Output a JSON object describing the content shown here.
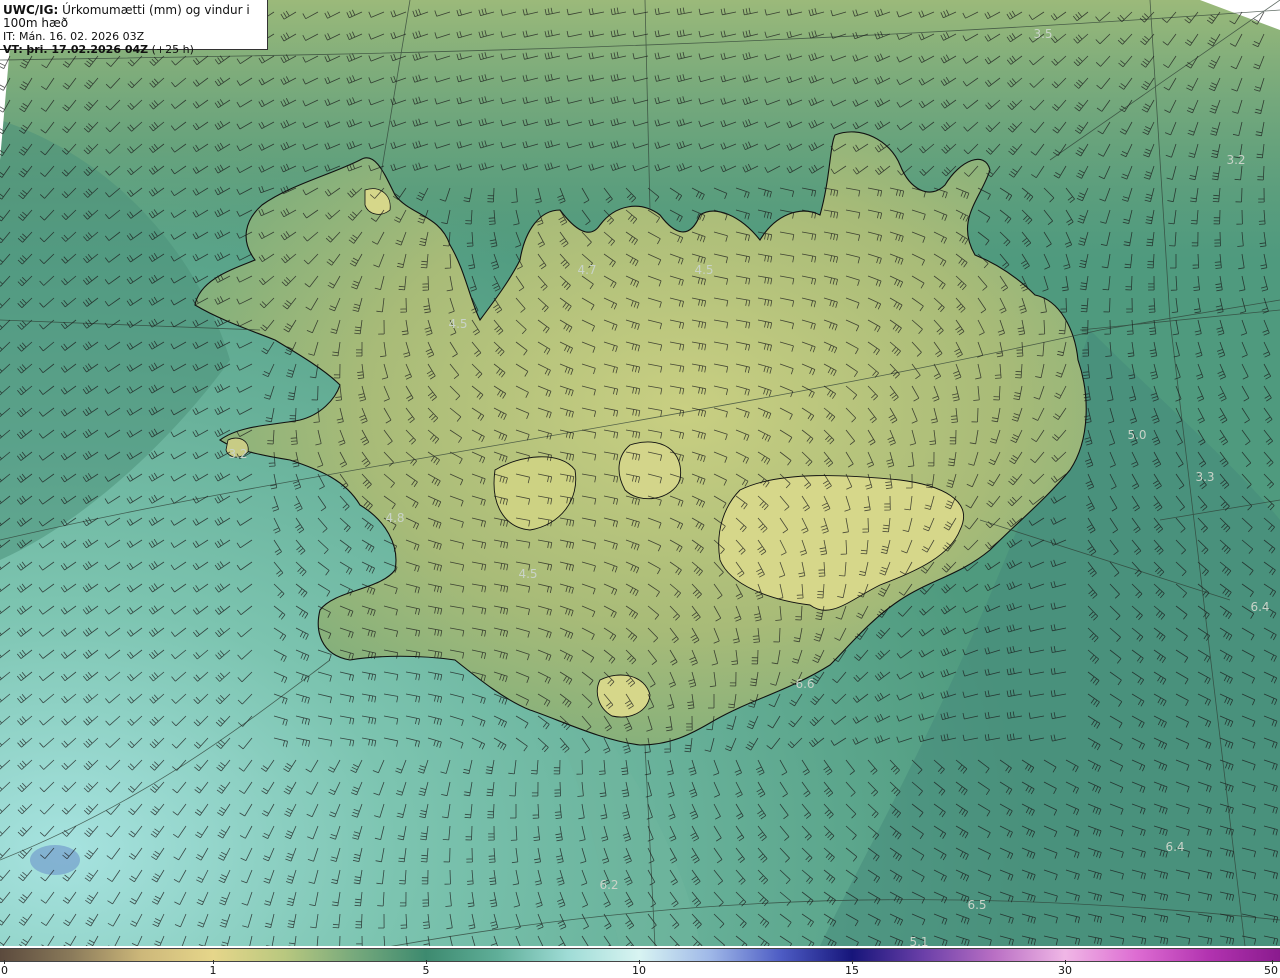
{
  "info": {
    "model": "UWC/IG:",
    "title": "Úrkomumætti (mm) og vindur i 100m hæð",
    "init_time": "IT: Mán. 16. 02. 2026 03Z",
    "valid_prefix": "VT:",
    "valid_time": "þri. 17.02.2026 04Z",
    "forecast_offset": "(+25 h)"
  },
  "colors": {
    "sea_dark": "#3f8a72",
    "sea_mid": "#5aa58a",
    "sea_light": "#a7e3e0",
    "land_low": "#6ea77c",
    "land_high": "#c7ce7f",
    "coastline": "#111111",
    "barb": "#1a1a1a"
  },
  "value_labels": [
    {
      "text": "3.5"
    },
    {
      "text": "3.2"
    },
    {
      "text": "4.7"
    },
    {
      "text": "4.5"
    },
    {
      "text": "4.5"
    },
    {
      "text": "3.2"
    },
    {
      "text": "4.8"
    },
    {
      "text": "4.5"
    },
    {
      "text": "5.0"
    },
    {
      "text": "3.3"
    },
    {
      "text": "6.4"
    },
    {
      "text": "6.6"
    },
    {
      "text": "6.4"
    },
    {
      "text": "6.2"
    },
    {
      "text": "6.5"
    },
    {
      "text": "5.1"
    }
  ],
  "colorbar": {
    "ticks": [
      "0",
      "1",
      "5",
      "10",
      "15",
      "30",
      "50"
    ]
  }
}
